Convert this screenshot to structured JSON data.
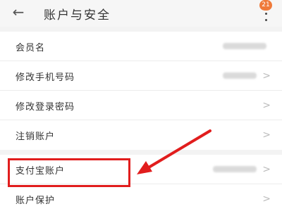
{
  "header": {
    "back_icon": "arrow-left-icon",
    "title": "账户与安全",
    "more_icon": "more-vertical-icon",
    "badge": "21"
  },
  "settings": [
    {
      "label": "会员名",
      "has_value": true,
      "has_chevron": false
    },
    {
      "label": "修改手机号码",
      "has_value": true,
      "has_chevron": true
    },
    {
      "label": "修改登录密码",
      "has_value": false,
      "has_chevron": true
    },
    {
      "label": "注销账户",
      "has_value": false,
      "has_chevron": true
    },
    {
      "label": "支付宝账户",
      "has_value": true,
      "has_chevron": true
    },
    {
      "label": "账户保护",
      "has_value": false,
      "has_chevron": true
    }
  ],
  "chevron_glyph": ">",
  "annotation": {
    "color": "#e11d1d"
  },
  "colors": {
    "badge": "#ef7a3a",
    "background": "#f3f3f3"
  }
}
